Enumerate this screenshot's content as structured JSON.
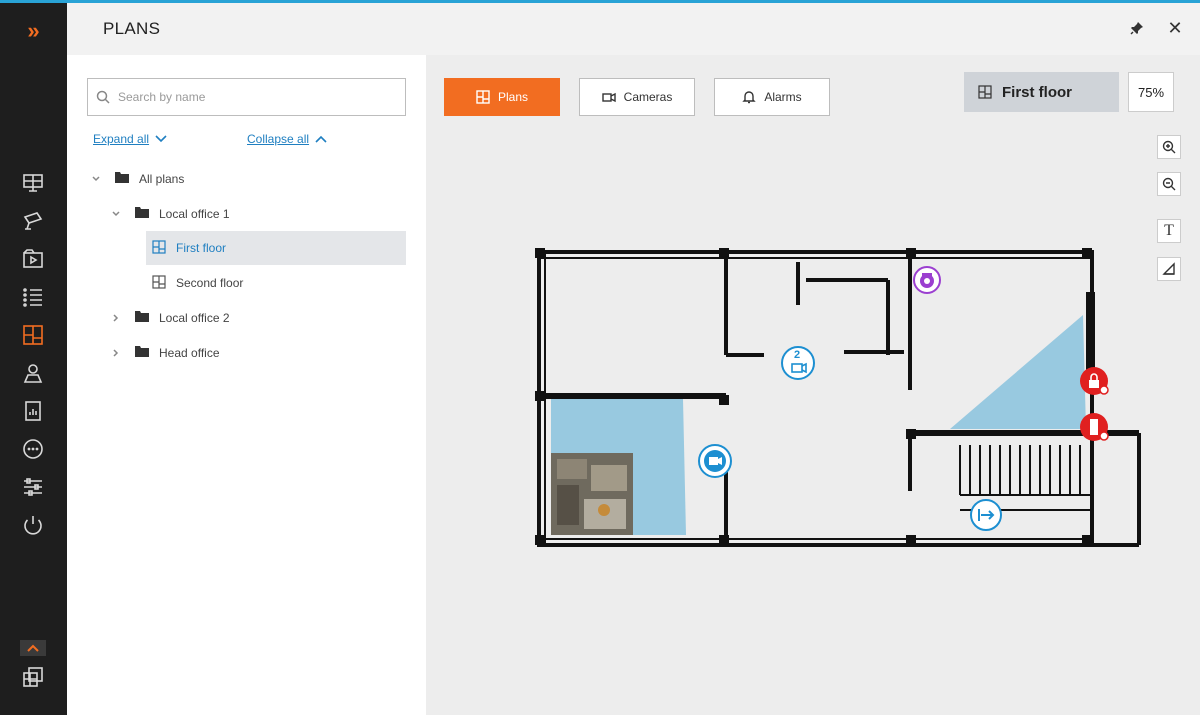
{
  "header": {
    "title": "PLANS"
  },
  "search": {
    "placeholder": "Search by name"
  },
  "tree_controls": {
    "expand_all": "Expand all",
    "collapse_all": "Collapse all"
  },
  "tree": {
    "root": "All plans",
    "local_office_1": "Local office 1",
    "first_floor": "First floor",
    "second_floor": "Second floor",
    "local_office_2": "Local office 2",
    "head_office": "Head office"
  },
  "tabs": {
    "plans": "Plans",
    "cameras": "Cameras",
    "alarms": "Alarms"
  },
  "current_plan": "First floor",
  "zoom": "75%",
  "markers": {
    "camera_group_count": "2"
  },
  "colors": {
    "accent": "#f26d21",
    "link": "#1f7fc1",
    "zone": "#8ec4de",
    "alarm": "#e02020",
    "ptz": "#9b3fd0",
    "camera": "#1d8fd1"
  },
  "icons": {
    "rail": [
      "monitor-icon",
      "camera-icon",
      "archive-icon",
      "event-list-icon",
      "plans-icon",
      "user-map-icon",
      "reports-icon",
      "more-icon",
      "settings-icon",
      "power-icon",
      "windows-icon"
    ]
  }
}
